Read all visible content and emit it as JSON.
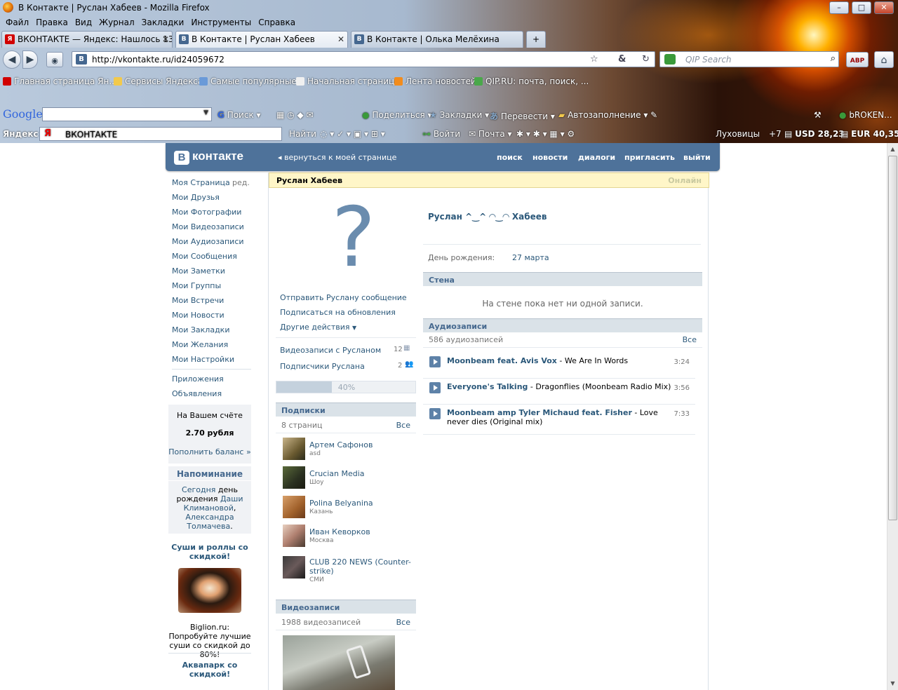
{
  "window": {
    "title": "В Контакте | Руслан Хабеев - Mozilla Firefox",
    "controls": [
      "–",
      "□",
      "✕"
    ]
  },
  "menu": [
    "Файл",
    "Правка",
    "Вид",
    "Журнал",
    "Закладки",
    "Инструменты",
    "Справка"
  ],
  "tabs": [
    {
      "label": "ВКОНТАКТЕ — Яндекс: Нашлось 13...",
      "fav": "Я",
      "fav_color": "#d10000",
      "active": false
    },
    {
      "label": "В Контакте | Руслан Хабеев",
      "fav": "B",
      "fav_color": "#45678f",
      "active": true
    },
    {
      "label": "В Контакте | Олька Мелёхина",
      "fav": "B",
      "fav_color": "#45678f",
      "active": false
    }
  ],
  "newtab": "+",
  "nav": {
    "url": "http://vkontakte.ru/id24059672",
    "url_fav": "B",
    "qip_placeholder": "QIP Search",
    "abp": "ABP"
  },
  "bookmarks": [
    "Главная страница Ян...",
    "Сервисы Яндекса",
    "Самые популярные",
    "Начальная страница",
    "Лента новостей",
    "QIP.RU: почта, поиск, ..."
  ],
  "googlebar": {
    "logo": "Google",
    "items": [
      "Поиск",
      "Поделиться",
      "Закладки",
      "Перевести",
      "Автозаполнение",
      "bROKEN..."
    ]
  },
  "yandexbar": {
    "label": "Яндекс",
    "search_text": "ВКОНТАКТЕ",
    "items": [
      "Найти",
      "Войти",
      "Почта"
    ],
    "city": "Луховицы",
    "temp": "+7",
    "usd": "USD 28,23",
    "eur": "EUR 40,35"
  },
  "vk": {
    "logo_letter": "В",
    "logo_text": "контакте",
    "back": "вернуться к моей странице",
    "top_nav": [
      "поиск",
      "новости",
      "диалоги",
      "пригласить",
      "выйти"
    ],
    "left_menu": [
      "Моя Страница",
      "Мои Друзья",
      "Мои Фотографии",
      "Мои Видеозаписи",
      "Мои Аудиозаписи",
      "Мои Сообщения",
      "Мои Заметки",
      "Мои Группы",
      "Мои Встречи",
      "Мои Новости",
      "Мои Закладки",
      "Мои Желания",
      "Мои Настройки"
    ],
    "edit": "ред.",
    "extra_menu": [
      "Приложения",
      "Объявления"
    ],
    "balance": {
      "label": "На Вашем счёте",
      "value": "2.70 рубля",
      "link": "Пополнить баланс »"
    },
    "reminder": {
      "title": "Напоминание",
      "l1a": "Сегодня",
      "l1b": "день",
      "l2a": "рождения",
      "l2b": "Даши",
      "l3": "Климановой",
      "l4": "Александра",
      "l5": "Толмачева"
    },
    "ad1": {
      "title": "Суши и роллы со скидкой!",
      "text": "Biglion.ru: Попробуйте лучшие суши со скидкой до 80%!"
    },
    "ad2": {
      "title": "Аквапарк со скидкой!"
    },
    "profile": {
      "name": "Руслан Хабеев",
      "status": "Онлайн",
      "fullname": "Руслан ^‿^ ◠‿◠ Хабеев",
      "birthday_label": "День рождения:",
      "birthday": "27 марта",
      "actions": [
        "Отправить Руслану сообщение",
        "Подписаться на обновления",
        "Другие действия"
      ],
      "videos_with": "Видеозаписи с Русланом",
      "videos_count": "12",
      "followers": "Подписчики Руслана",
      "followers_count": "2",
      "progress_label": "40%",
      "progress": 0.4
    },
    "subscriptions": {
      "title": "Подписки",
      "count": "8 страниц",
      "all": "Все",
      "items": [
        {
          "name": "Артем Сафонов",
          "desc": "asd"
        },
        {
          "name": "Crucian Media",
          "desc": "Шоу"
        },
        {
          "name": "Polina Belyanina",
          "desc": "Казань"
        },
        {
          "name": "Иван Кеворков",
          "desc": "Москва"
        },
        {
          "name": "CLUB 220 NEWS (Counter-",
          "name2": "strike)",
          "desc": "СМИ"
        }
      ]
    },
    "videos": {
      "title": "Видеозаписи",
      "count": "1988 видеозаписей",
      "all": "Все"
    },
    "wall": {
      "title": "Стена",
      "empty": "На стене пока нет ни одной записи."
    },
    "audio": {
      "title": "Аудиозаписи",
      "count": "586 аудиозаписей",
      "all": "Все",
      "tracks": [
        {
          "artist": "Moonbeam feat. Avis Vox",
          "song": " - We Are In Words",
          "dur": "3:24"
        },
        {
          "artist": "Everyone's Talking",
          "song": " - Dragonflies (Moonbeam Radio Mix)",
          "dur": "3:56"
        },
        {
          "artist": "Moonbeam amp Tyler Michaud feat. Fisher",
          "song": " - Love never dies (Original mix)",
          "dur": "7:33"
        }
      ]
    }
  },
  "colors": {
    "vk_blue": "#4e729a",
    "link": "#2b587a",
    "header_bg": "#dae2e8",
    "title_bg": "#fff6c8"
  }
}
